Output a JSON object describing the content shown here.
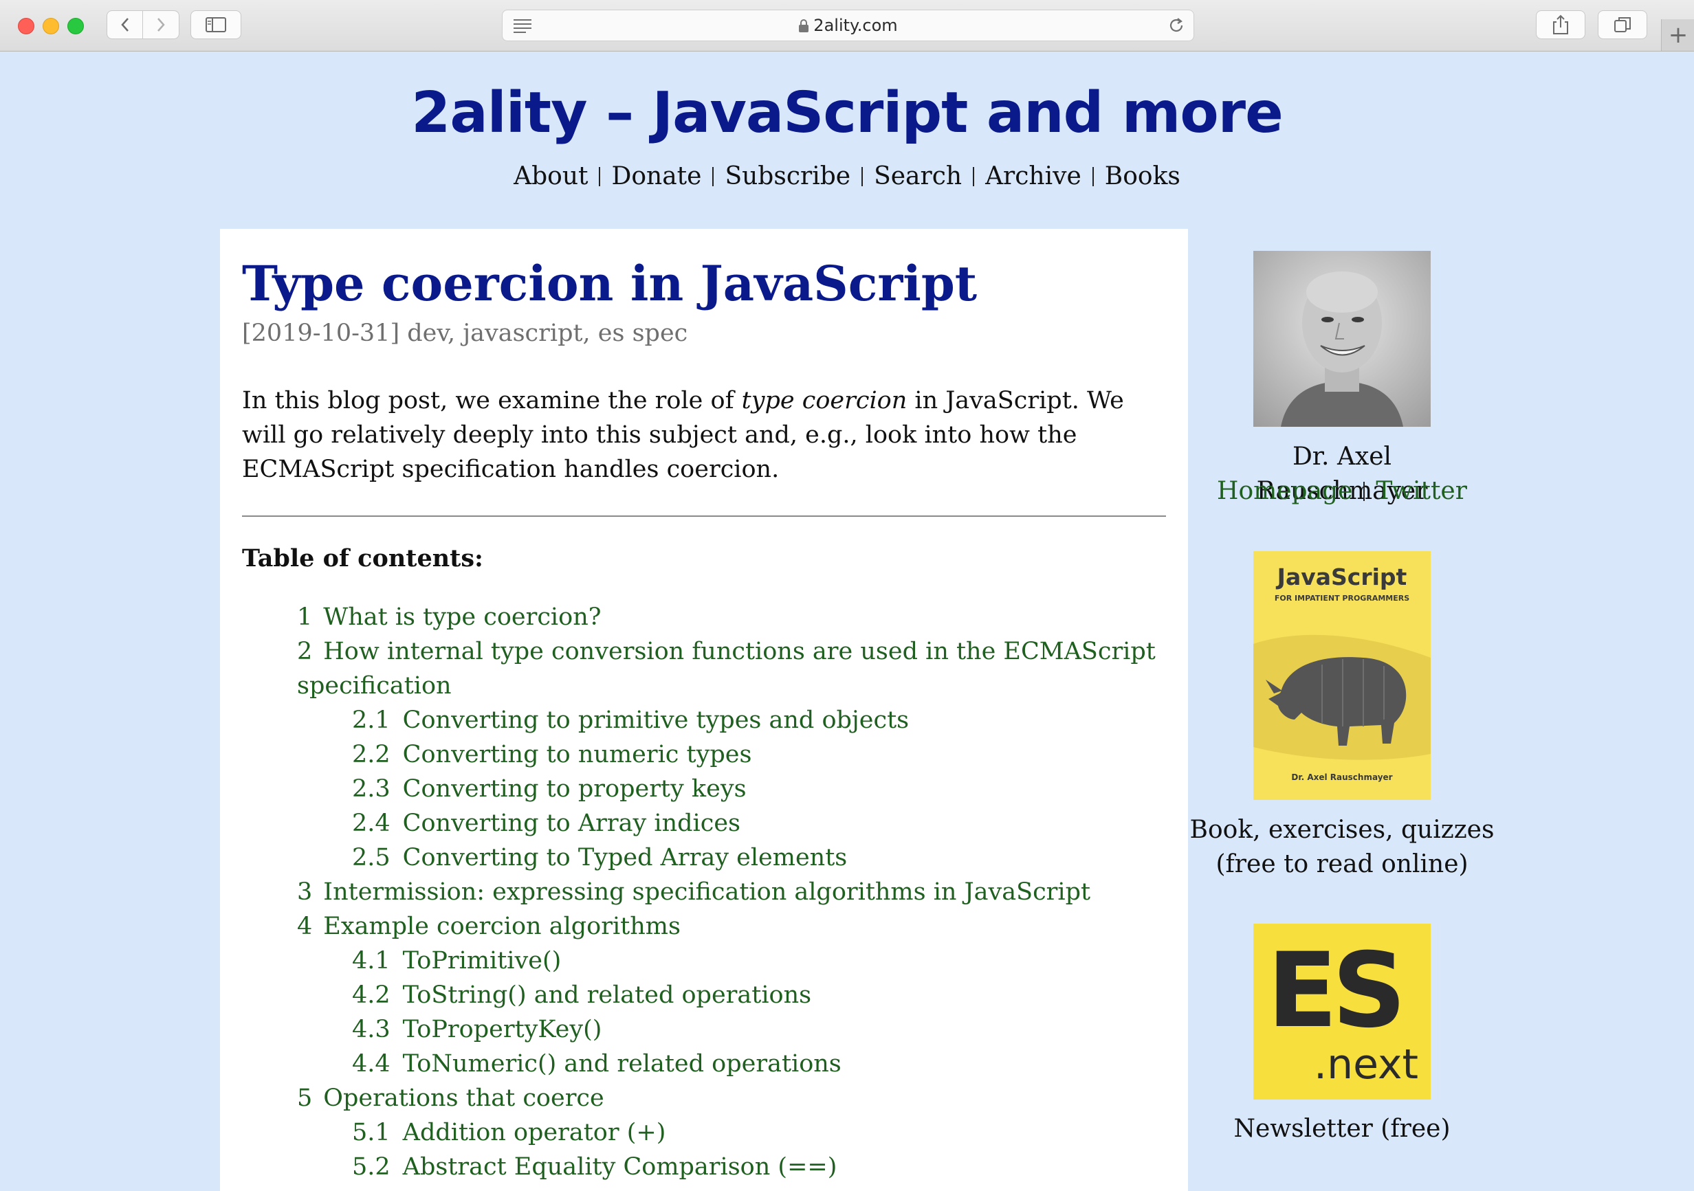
{
  "browser": {
    "url": "2ality.com"
  },
  "site": {
    "title": "2ality – JavaScript and more",
    "nav": [
      "About",
      "Donate",
      "Subscribe",
      "Search",
      "Archive",
      "Books"
    ]
  },
  "post": {
    "title": "Type coercion in JavaScript",
    "meta": "[2019-10-31] dev, javascript, es spec",
    "intro_before": "In this blog post, we examine the role of ",
    "intro_em": "type coercion",
    "intro_after": " in JavaScript. We will go relatively deeply into this subject and, e.g., look into how the ECMAScript specification handles coercion.",
    "toc_heading": "Table of contents:",
    "toc": [
      {
        "num": "1",
        "label": "What is type coercion?",
        "level": 1
      },
      {
        "num": "2",
        "label": "How internal type conversion functions are used in the ECMAScript specification",
        "level": 1
      },
      {
        "num": "2.1",
        "label": "Converting to primitive types and objects",
        "level": 2
      },
      {
        "num": "2.2",
        "label": "Converting to numeric types",
        "level": 2
      },
      {
        "num": "2.3",
        "label": "Converting to property keys",
        "level": 2
      },
      {
        "num": "2.4",
        "label": "Converting to Array indices",
        "level": 2
      },
      {
        "num": "2.5",
        "label": "Converting to Typed Array elements",
        "level": 2
      },
      {
        "num": "3",
        "label": "Intermission: expressing specification algorithms in JavaScript",
        "level": 1
      },
      {
        "num": "4",
        "label": "Example coercion algorithms",
        "level": 1
      },
      {
        "num": "4.1",
        "label": "ToPrimitive()",
        "level": 2
      },
      {
        "num": "4.2",
        "label": "ToString() and related operations",
        "level": 2
      },
      {
        "num": "4.3",
        "label": "ToPropertyKey()",
        "level": 2
      },
      {
        "num": "4.4",
        "label": "ToNumeric() and related operations",
        "level": 2
      },
      {
        "num": "5",
        "label": "Operations that coerce",
        "level": 1
      },
      {
        "num": "5.1",
        "label": "Addition operator (+)",
        "level": 2
      },
      {
        "num": "5.2",
        "label": "Abstract Equality Comparison (==)",
        "level": 2
      }
    ]
  },
  "sidebar": {
    "author_name": "Dr. Axel Rauschmayer",
    "links": [
      "Homepage",
      "Twitter"
    ],
    "book": {
      "cover_title": "JavaScript",
      "cover_subtitle": "FOR IMPATIENT PROGRAMMERS",
      "cover_author": "Dr. Axel Rauschmayer",
      "caption_line1": "Book, exercises, quizzes",
      "caption_line2": "(free to read online)"
    },
    "newsletter": {
      "logo_big": "ES",
      "logo_small": ".next",
      "caption": "Newsletter (free)"
    }
  }
}
